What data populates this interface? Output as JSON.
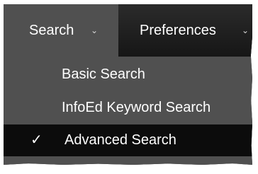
{
  "menubar": {
    "search_label": "Search",
    "preferences_label": "Preferences"
  },
  "dropdown": {
    "items": [
      {
        "label": "Basic Search",
        "checked": false
      },
      {
        "label": "InfoEd Keyword Search",
        "checked": false
      },
      {
        "label": "Advanced Search",
        "checked": true
      }
    ],
    "check_glyph": "✓"
  },
  "colors": {
    "menu_bg": "#505050",
    "menubar_dark": "#1f1f1f",
    "selected_bg": "#0c0c0c",
    "text": "#ffffff"
  },
  "icons": {
    "dropdown_caret": "caret-down-icon",
    "selected_mark": "checkmark-icon"
  }
}
